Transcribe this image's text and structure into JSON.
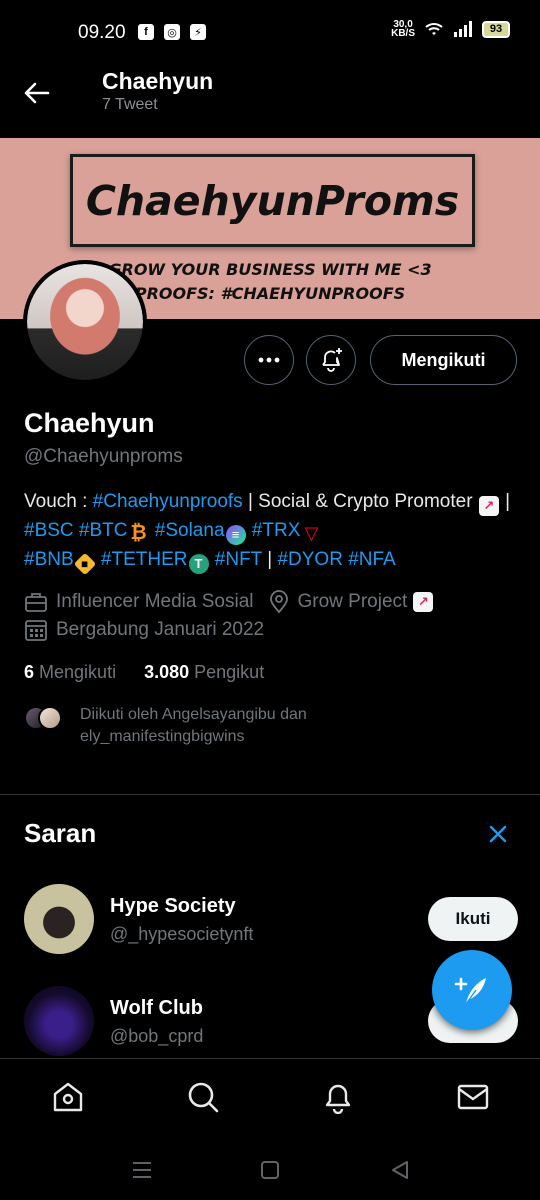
{
  "status_bar": {
    "time": "09.20",
    "left_icons": [
      "facebook-icon",
      "instagram-icon",
      "shield-icon"
    ],
    "speed_value": "30,0",
    "speed_unit": "KB/S",
    "battery": "93"
  },
  "header": {
    "title": "Chaehyun",
    "subtitle": "7 Tweet"
  },
  "banner": {
    "title": "ChaehyunProms",
    "line1": "GROW YOUR BUSINESS WITH ME <3",
    "line2": "PROOFS: #CHAEHYUNPROOFS",
    "background": "#d9a197"
  },
  "actions": {
    "follow_label": "Mengikuti"
  },
  "profile": {
    "name": "Chaehyun",
    "handle": "@Chaehyunproms",
    "bio": {
      "vouch_prefix": "Vouch : ",
      "vouch_tag": "#Chaehyunproofs",
      "sep1": " | Social & Crypto Promoter ",
      "sep2": " | ",
      "bsc": "#BSC",
      "btc": "#BTC",
      "solana": "#Solana",
      "trx": "#TRX",
      "bnb": "#BNB",
      "tether": "#TETHER",
      "nft": "#NFT",
      "sep3": " | ",
      "dyor": "#DYOR",
      "nfa": "#NFA"
    },
    "category": "Influencer Media Sosial",
    "location": "Grow Project",
    "joined": "Bergabung Januari 2022",
    "following_count": "6",
    "following_label": "Mengikuti",
    "followers_count": "3.080",
    "followers_label": "Pengikut",
    "followed_by": "Diikuti oleh Angelsayangibu dan ely_manifestingbigwins"
  },
  "suggestions": {
    "title": "Saran",
    "items": [
      {
        "name": "Hype Society",
        "handle": "@_hypesocietynft",
        "button": "Ikuti"
      },
      {
        "name": "Wolf Club",
        "handle": "@bob_cprd",
        "button": "Ikuti"
      }
    ]
  },
  "colors": {
    "accent": "#1d9bf0",
    "background": "#000000",
    "muted": "#71767b"
  }
}
